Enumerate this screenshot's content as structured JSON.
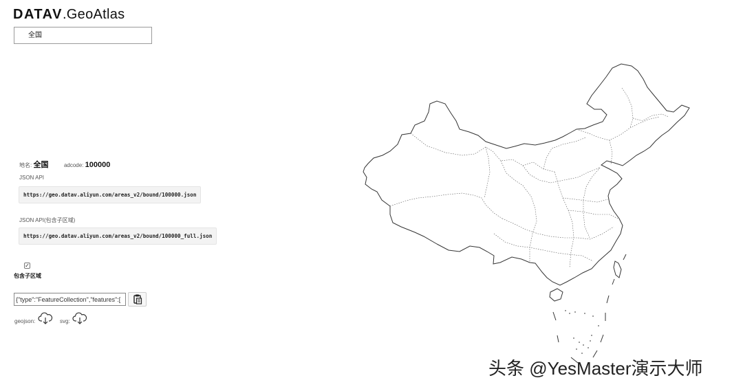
{
  "logo": {
    "bold": "DATAV",
    "rest": ".GeoAtlas"
  },
  "region_select": {
    "value": "全国"
  },
  "info": {
    "name_label": "地名:",
    "name_value": "全国",
    "adcode_label": "adcode:",
    "adcode_value": "100000"
  },
  "json_api": {
    "label": "JSON API",
    "url": "https://geo.datav.aliyun.com/areas_v2/bound/100000.json"
  },
  "json_api_full": {
    "label": "JSON API(包含子区域)",
    "url": "https://geo.datav.aliyun.com/areas_v2/bound/100000_full.json"
  },
  "include_sub": {
    "checked": true,
    "label": "包含子区域"
  },
  "geojson_input": {
    "value": "{\"type\":\"FeatureCollection\",\"features\":["
  },
  "downloads": {
    "geojson_label": "geojson:",
    "svg_label": "svg:",
    "icon": "cloud-download-icon"
  },
  "copy_icon": "clipboard-icon",
  "watermark": "头条 @YesMaster演示大师"
}
